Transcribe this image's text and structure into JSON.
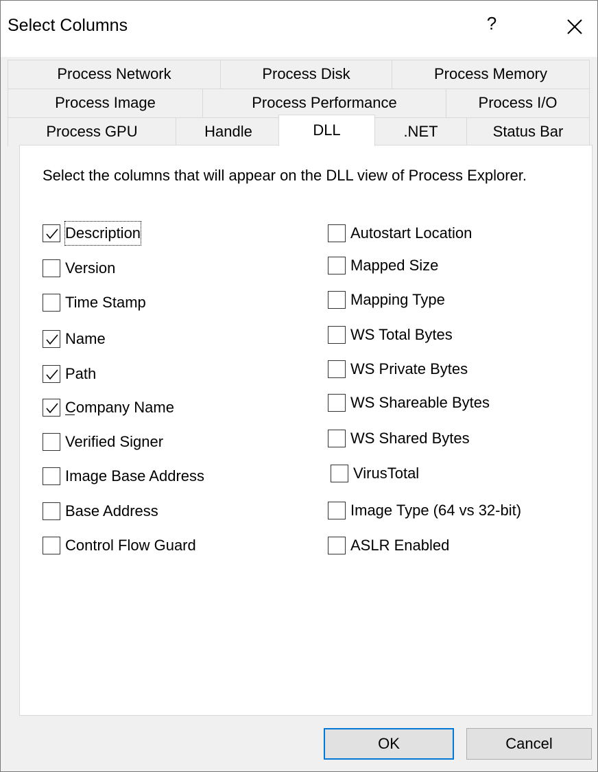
{
  "window": {
    "title": "Select Columns",
    "help_label": "?"
  },
  "tabs": {
    "row1": [
      "Process Network",
      "Process Disk",
      "Process Memory"
    ],
    "row2": [
      "Process Image",
      "Process Performance",
      "Process I/O"
    ],
    "row3": [
      "Process GPU",
      "Handle",
      "DLL",
      ".NET",
      "Status Bar"
    ],
    "active": "DLL"
  },
  "panel": {
    "intro_text": "Select the columns that will appear on the DLL view of Process Explorer.",
    "left_column": [
      {
        "label": "Description",
        "checked": true,
        "focused": true
      },
      {
        "label": "Version",
        "checked": false
      },
      {
        "label": "Time Stamp",
        "checked": false
      },
      {
        "label": "Name",
        "checked": true
      },
      {
        "label": "Path",
        "checked": true
      },
      {
        "label": "Company Name",
        "checked": true,
        "mnemonic": "C"
      },
      {
        "label": "Verified Signer",
        "checked": false
      },
      {
        "label": "Image Base Address",
        "checked": false
      },
      {
        "label": "Base Address",
        "checked": false
      },
      {
        "label": "Control Flow Guard",
        "checked": false
      }
    ],
    "right_column": [
      {
        "label": "Autostart Location",
        "checked": false
      },
      {
        "label": "Mapped Size",
        "checked": false
      },
      {
        "label": "Mapping Type",
        "checked": false
      },
      {
        "label": "WS Total Bytes",
        "checked": false
      },
      {
        "label": "WS Private Bytes",
        "checked": false
      },
      {
        "label": "WS Shareable Bytes",
        "checked": false
      },
      {
        "label": "WS Shared Bytes",
        "checked": false
      },
      {
        "label": "VirusTotal",
        "checked": false
      },
      {
        "label": "Image Type (64 vs 32-bit)",
        "checked": false
      },
      {
        "label": "ASLR Enabled",
        "checked": false
      }
    ]
  },
  "buttons": {
    "ok": "OK",
    "cancel": "Cancel"
  },
  "colors": {
    "accent": "#0078d7",
    "dialog_bg": "#f0f0f0",
    "panel_bg": "#ffffff"
  }
}
